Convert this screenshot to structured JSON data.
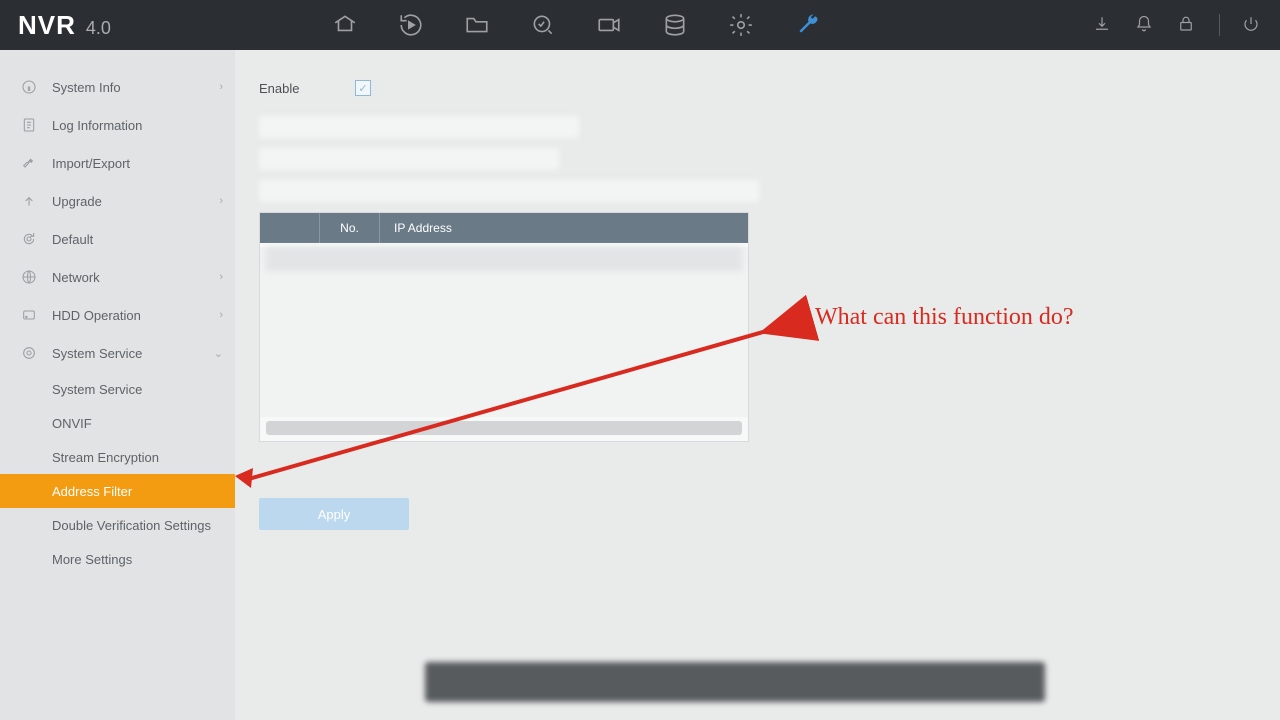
{
  "header": {
    "brand": "NVR",
    "version": "4.0"
  },
  "sidebar": {
    "items": [
      {
        "label": "System Info",
        "icon": "info-icon",
        "expand": true
      },
      {
        "label": "Log Information",
        "icon": "log-icon",
        "expand": false
      },
      {
        "label": "Import/Export",
        "icon": "wrench-icon",
        "expand": false
      },
      {
        "label": "Upgrade",
        "icon": "upgrade-icon",
        "expand": true
      },
      {
        "label": "Default",
        "icon": "gear-reset-icon",
        "expand": false
      },
      {
        "label": "Network",
        "icon": "globe-icon",
        "expand": true
      },
      {
        "label": "HDD Operation",
        "icon": "hdd-icon",
        "expand": true
      },
      {
        "label": "System Service",
        "icon": "service-icon",
        "expand": true
      }
    ],
    "subitems": [
      {
        "label": "System Service",
        "selected": false
      },
      {
        "label": "ONVIF",
        "selected": false
      },
      {
        "label": "Stream Encryption",
        "selected": false
      },
      {
        "label": "Address Filter",
        "selected": true
      },
      {
        "label": "Double Verification Settings",
        "selected": false
      },
      {
        "label": "More Settings",
        "selected": false
      }
    ]
  },
  "content": {
    "enable_label": "Enable",
    "table": {
      "col_no": "No.",
      "col_ip": "IP Address"
    },
    "apply_label": "Apply"
  },
  "annotation": {
    "text": "What can this function do?"
  }
}
